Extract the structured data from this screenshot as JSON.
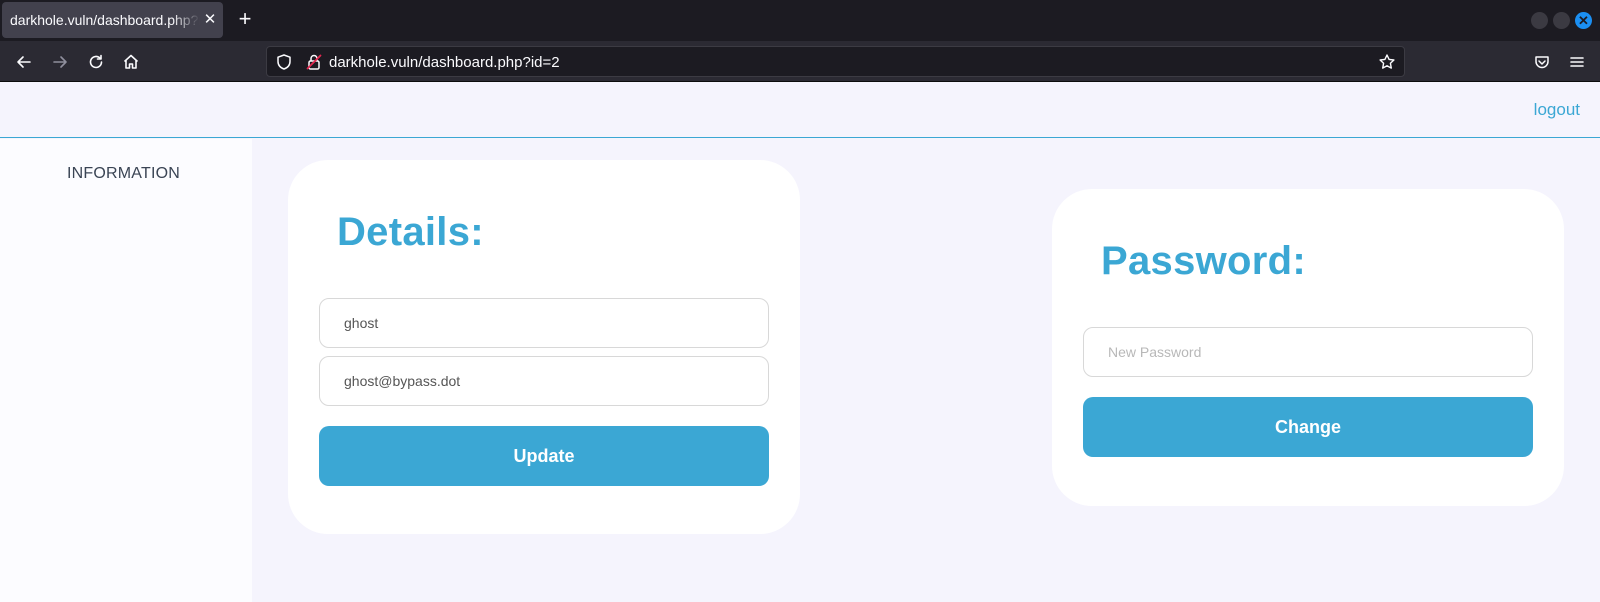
{
  "browser": {
    "tab_title": "darkhole.vuln/dashboard.php?id=2",
    "tab_close": "✕",
    "new_tab": "+",
    "url": "darkhole.vuln/dashboard.php?id=2",
    "window_close": "✕"
  },
  "header": {
    "logout_label": "logout"
  },
  "sidebar": {
    "items": [
      {
        "label": "INFORMATION"
      }
    ]
  },
  "details": {
    "title": "Details:",
    "username_value": "ghost",
    "email_value": "ghost@bypass.dot",
    "update_label": "Update"
  },
  "password": {
    "title": "Password:",
    "new_password_placeholder": "New Password",
    "change_label": "Change"
  },
  "colors": {
    "accent": "#3ba7d4",
    "page_bg": "#f5f4fd",
    "chrome_dark": "#1c1b22",
    "chrome_toolbar": "#2b2a33"
  },
  "icons": [
    "back-arrow-icon",
    "forward-arrow-icon",
    "reload-icon",
    "home-icon",
    "shield-icon",
    "insecure-lock-icon",
    "bookmark-star-icon",
    "pocket-icon",
    "hamburger-menu-icon"
  ]
}
